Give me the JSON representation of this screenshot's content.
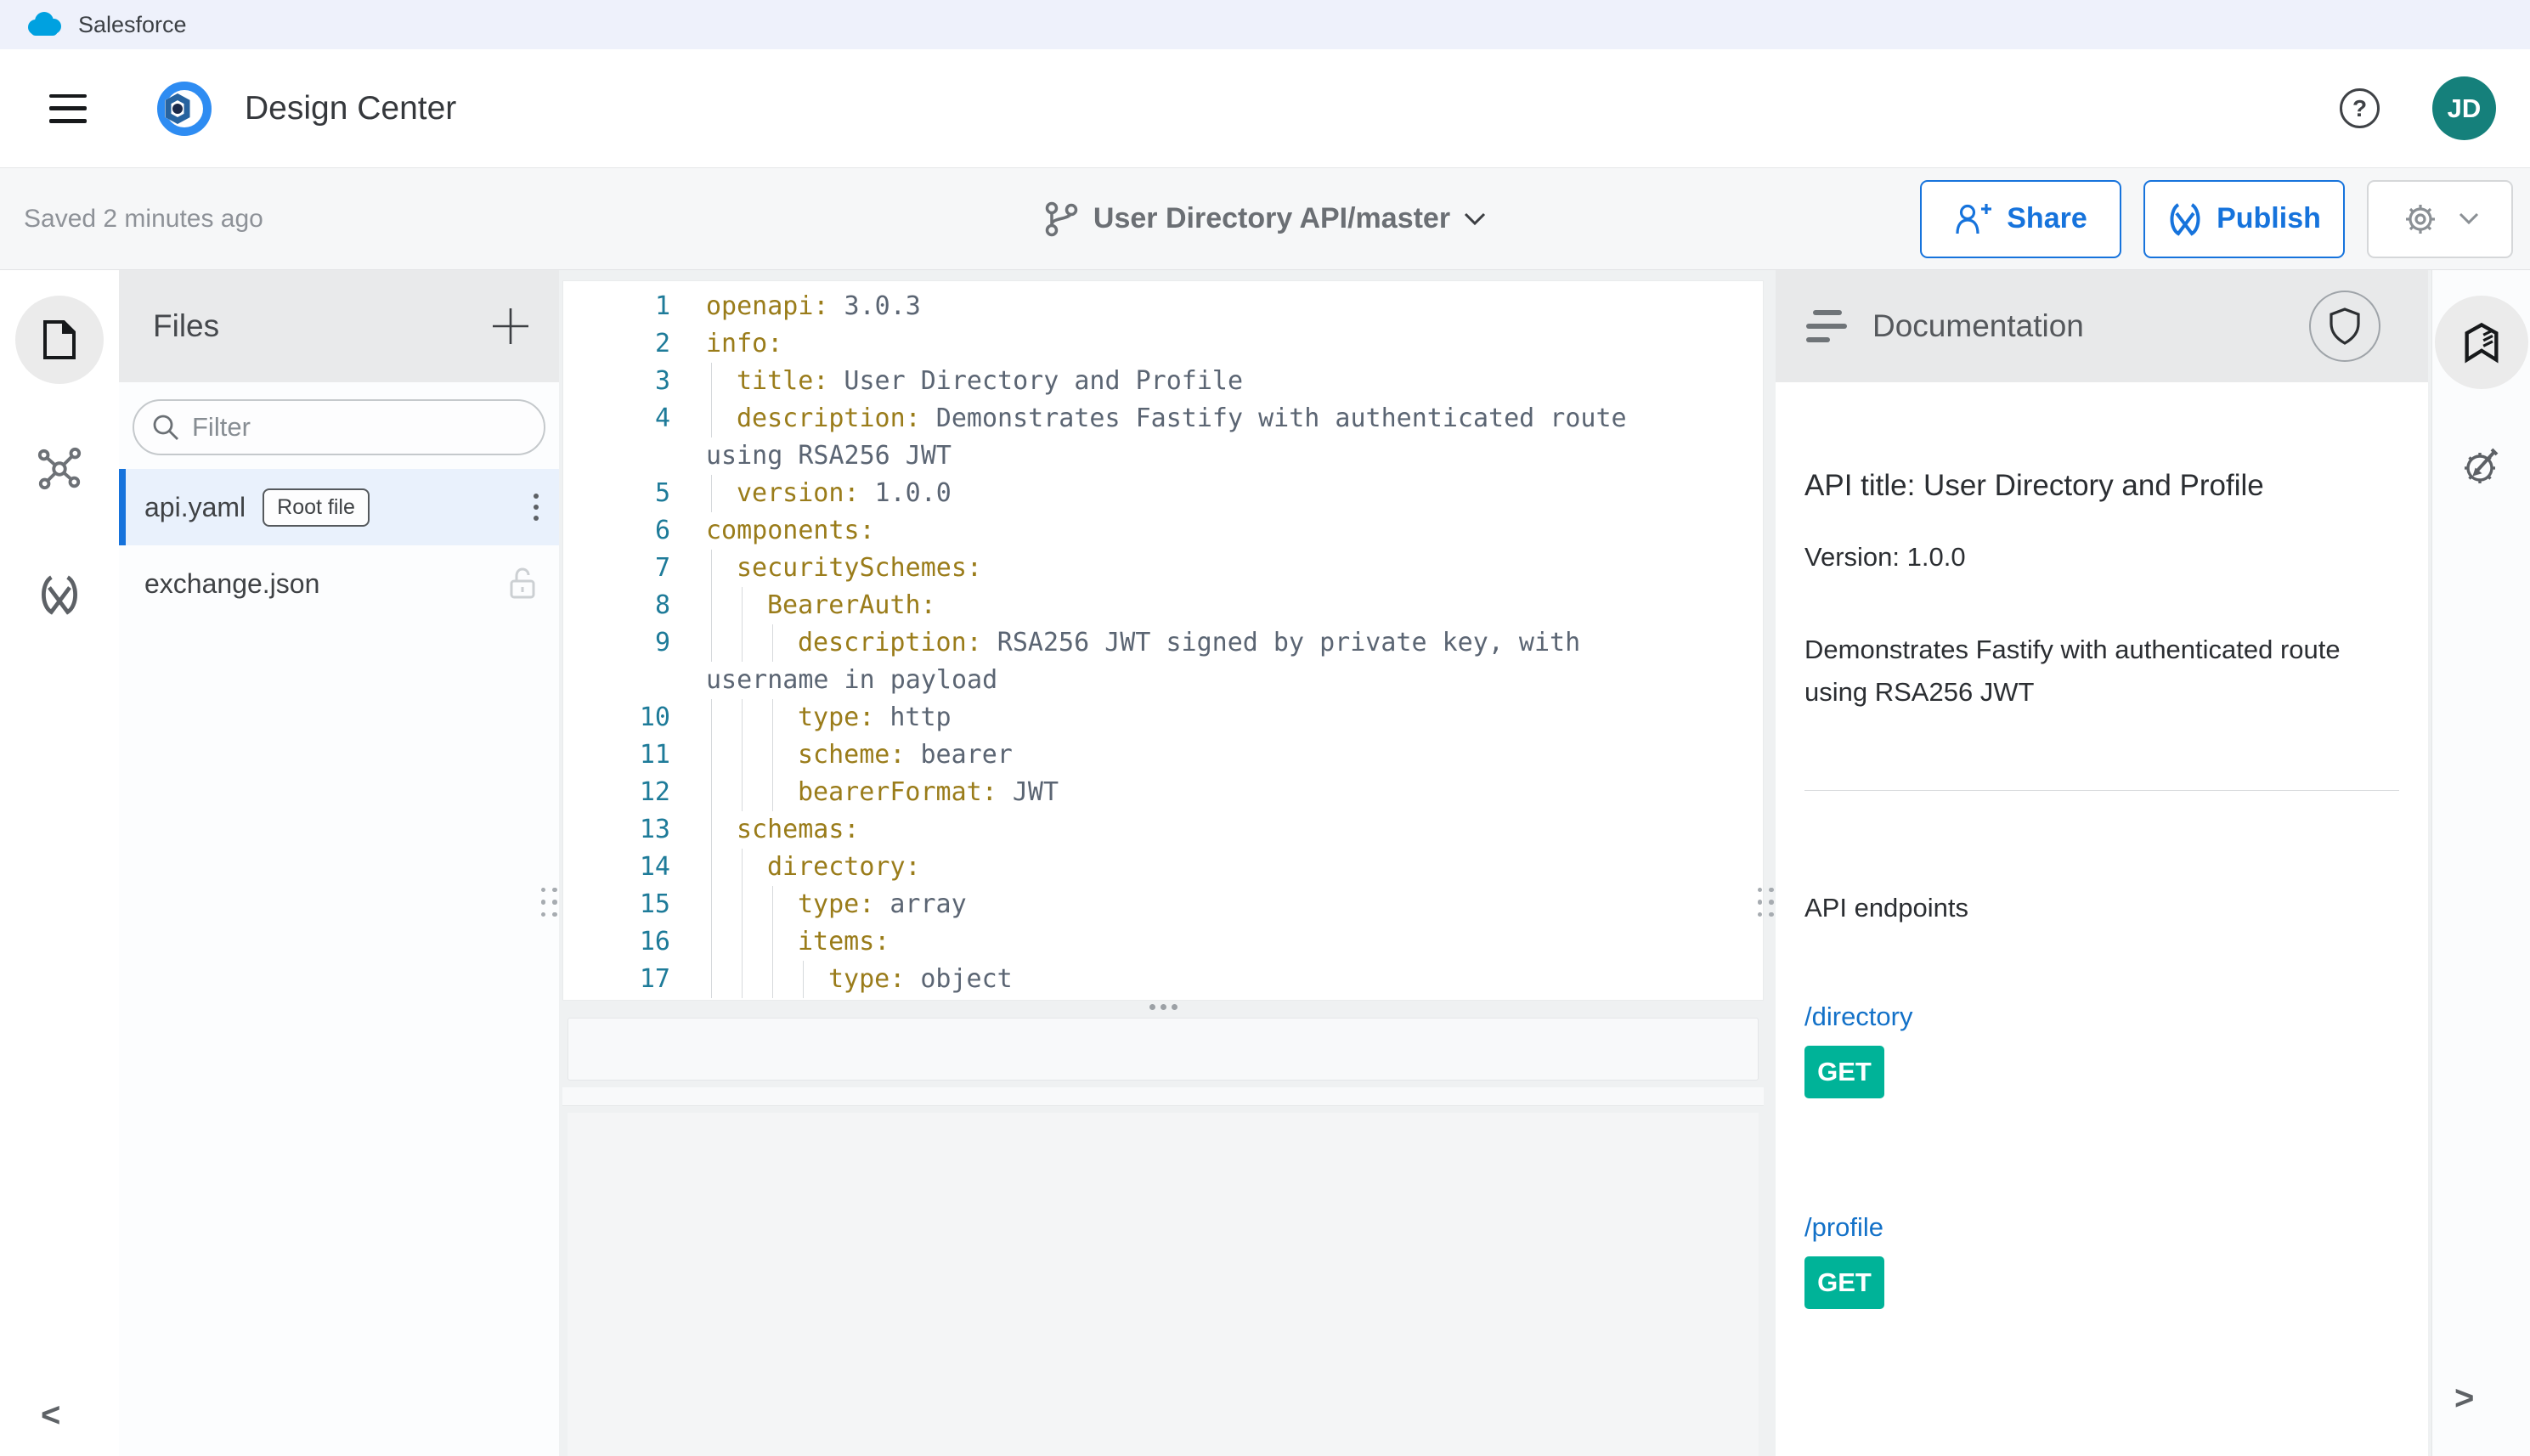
{
  "top_bar": {
    "brand": "Salesforce"
  },
  "header": {
    "app_title": "Design Center",
    "help_glyph": "?",
    "avatar_initials": "JD"
  },
  "toolbar": {
    "saved_status": "Saved 2 minutes ago",
    "project": "User Directory API/master",
    "share_label": "Share",
    "publish_label": "Publish"
  },
  "files_panel": {
    "title": "Files",
    "filter_placeholder": "Filter",
    "items": [
      {
        "name": "api.yaml",
        "badge": "Root file",
        "selected": true
      },
      {
        "name": "exchange.json",
        "locked": true
      }
    ]
  },
  "editor": {
    "language": "yaml",
    "lines": [
      {
        "num": "1",
        "indent": 0,
        "key": "openapi:",
        "value": "3.0.3"
      },
      {
        "num": "2",
        "indent": 0,
        "key": "info:"
      },
      {
        "num": "3",
        "indent": 1,
        "key": "title:",
        "value": "User Directory and Profile"
      },
      {
        "num": "4",
        "indent": 1,
        "key": "description:",
        "value": "Demonstrates Fastify with authenticated route",
        "wrap": "using RSA256 JWT"
      },
      {
        "num": "5",
        "indent": 1,
        "key": "version:",
        "value": "1.0.0"
      },
      {
        "num": "6",
        "indent": 0,
        "key": "components:"
      },
      {
        "num": "7",
        "indent": 1,
        "key": "securitySchemes:"
      },
      {
        "num": "8",
        "indent": 2,
        "key": "BearerAuth:"
      },
      {
        "num": "9",
        "indent": 3,
        "key": "description:",
        "value": "RSA256 JWT signed by private key, with",
        "wrap": "username in payload"
      },
      {
        "num": "10",
        "indent": 3,
        "key": "type:",
        "value": "http"
      },
      {
        "num": "11",
        "indent": 3,
        "key": "scheme:",
        "value": "bearer"
      },
      {
        "num": "12",
        "indent": 3,
        "key": "bearerFormat:",
        "value": "JWT"
      },
      {
        "num": "13",
        "indent": 1,
        "key": "schemas:"
      },
      {
        "num": "14",
        "indent": 2,
        "key": "directory:"
      },
      {
        "num": "15",
        "indent": 3,
        "key": "type:",
        "value": "array"
      },
      {
        "num": "16",
        "indent": 3,
        "key": "items:"
      },
      {
        "num": "17",
        "indent": 4,
        "key": "type:",
        "value": "object"
      }
    ]
  },
  "documentation": {
    "title": "Documentation",
    "api_title": "API title: User Directory and Profile",
    "version": "Version: 1.0.0",
    "description": "Demonstrates Fastify with authenticated route using RSA256 JWT",
    "endpoints_heading": "API endpoints",
    "endpoints": [
      {
        "path": "/directory",
        "method": "GET"
      },
      {
        "path": "/profile",
        "method": "GET"
      }
    ]
  },
  "nav": {
    "back": "<",
    "forward": ">"
  },
  "icons": {
    "salesforce-logo": "cloud",
    "hamburger-menu": "three-bars",
    "design-center-logo": "ring-hexagon",
    "help-icon": "question-circle",
    "branch-icon": "git-branch",
    "chevron-down-icon": "chevron-down",
    "share-icon": "person-plus",
    "publish-icon": "exchange-x",
    "gear-icon": "gear",
    "file-icon": "page",
    "nodes-icon": "molecule",
    "exchange-icon": "exchange-x",
    "plus-icon": "plus",
    "search-icon": "magnifier",
    "kebab-icon": "vertical-dots",
    "lock-icon": "padlock",
    "toc-icon": "list-lines",
    "shield-icon": "shield",
    "book-icon": "bookmark-book",
    "gear-pencil-icon": "gear-pencil",
    "drag-handle-icon": "grip-dots"
  },
  "colors": {
    "accent_blue": "#1673dc",
    "link_blue": "#1371c8",
    "get_badge_teal": "#00b398",
    "avatar_teal": "#15807b",
    "selected_row_bg": "#e9f1fc",
    "code_key": "#9a7c1a",
    "code_value": "#5b6573",
    "line_number": "#1e7b99",
    "salesforce_bar_bg": "#eef1fb"
  }
}
